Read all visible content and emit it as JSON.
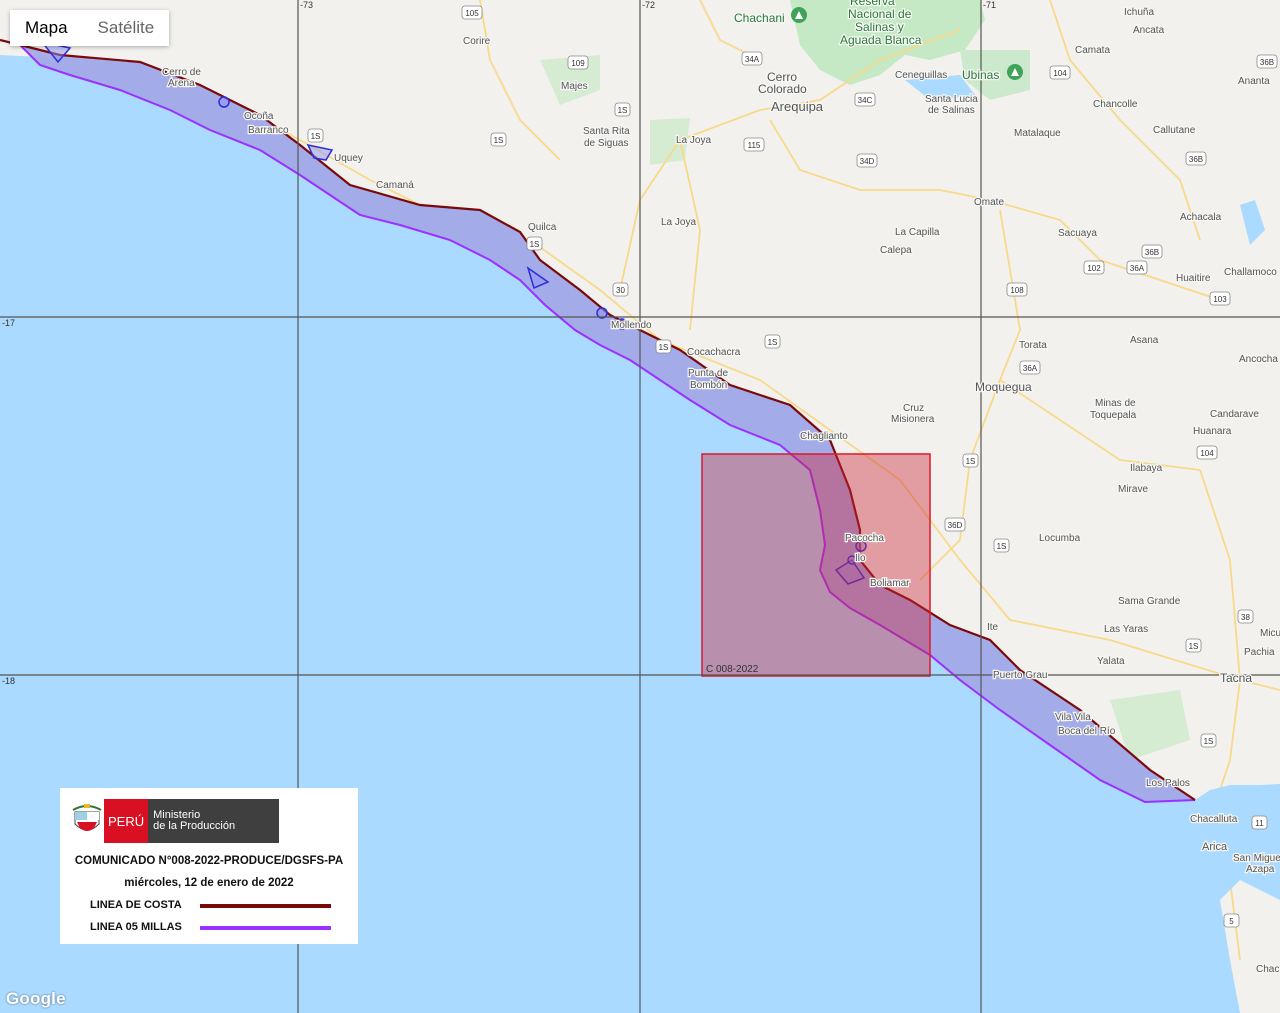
{
  "map_type": {
    "map_label": "Mapa",
    "satellite_label": "Satélite"
  },
  "grid": {
    "lon_labels": [
      "-73",
      "-72",
      "-71"
    ],
    "lat_labels": [
      "-17",
      "-18"
    ]
  },
  "places": [
    {
      "text": "Chachani"
    },
    {
      "text": "Reserva"
    },
    {
      "text": "Nacional de"
    },
    {
      "text": "Salinas y"
    },
    {
      "text": "Aguada Blanca"
    },
    {
      "text": "Ichuña"
    },
    {
      "text": "Ancata"
    },
    {
      "text": "Camata"
    },
    {
      "text": "Ananta"
    },
    {
      "text": "Corire"
    },
    {
      "text": "Cerro de"
    },
    {
      "text": "Arena"
    },
    {
      "text": "Majes"
    },
    {
      "text": "Cerro"
    },
    {
      "text": "Colorado"
    },
    {
      "text": "Arequipa"
    },
    {
      "text": "Ceneguillas"
    },
    {
      "text": "Ubinas"
    },
    {
      "text": "Santa Lucia"
    },
    {
      "text": "de Salinas"
    },
    {
      "text": "Chancolle"
    },
    {
      "text": "Ocoña"
    },
    {
      "text": "Barranco"
    },
    {
      "text": "Santa Rita"
    },
    {
      "text": "de Siguas"
    },
    {
      "text": "La Joya"
    },
    {
      "text": "Matalaque"
    },
    {
      "text": "Callutane"
    },
    {
      "text": "Uquey"
    },
    {
      "text": "Camaná"
    },
    {
      "text": "Omate"
    },
    {
      "text": "Achacala"
    },
    {
      "text": "Quilca"
    },
    {
      "text": "La Joya"
    },
    {
      "text": "La Capilla"
    },
    {
      "text": "Calepa"
    },
    {
      "text": "Sacuaya"
    },
    {
      "text": "Huaitire"
    },
    {
      "text": "Challamoco"
    },
    {
      "text": "Mollendo"
    },
    {
      "text": "Cocachacra"
    },
    {
      "text": "Torata"
    },
    {
      "text": "Asana"
    },
    {
      "text": "Ancocha"
    },
    {
      "text": "Punta de"
    },
    {
      "text": "Bombón"
    },
    {
      "text": "Moquegua"
    },
    {
      "text": "Cruz"
    },
    {
      "text": "Misionera"
    },
    {
      "text": "Minas de"
    },
    {
      "text": "Toquepala"
    },
    {
      "text": "Candarave"
    },
    {
      "text": "Huanara"
    },
    {
      "text": "Chaglianto"
    },
    {
      "text": "Ilabaya"
    },
    {
      "text": "Mirave"
    },
    {
      "text": "Pacocha"
    },
    {
      "text": "Ilo"
    },
    {
      "text": "Locumba"
    },
    {
      "text": "Boliamar"
    },
    {
      "text": "Sama Grande"
    },
    {
      "text": "Las Yaras"
    },
    {
      "text": "Ite"
    },
    {
      "text": "Micu"
    },
    {
      "text": "Pachia"
    },
    {
      "text": "Yalata"
    },
    {
      "text": "Puerto Grau"
    },
    {
      "text": "Tacna"
    },
    {
      "text": "Vila Vila"
    },
    {
      "text": "Boca del Río"
    },
    {
      "text": "Los Palos"
    },
    {
      "text": "Chacalluta"
    },
    {
      "text": "Arica"
    },
    {
      "text": "San Miguel de"
    },
    {
      "text": "Azapa"
    },
    {
      "text": "Chac"
    }
  ],
  "shields": [
    {
      "text": "105"
    },
    {
      "text": "109"
    },
    {
      "text": "1S"
    },
    {
      "text": "1S"
    },
    {
      "text": "1S"
    },
    {
      "text": "34A"
    },
    {
      "text": "34C"
    },
    {
      "text": "34D"
    },
    {
      "text": "115"
    },
    {
      "text": "104"
    },
    {
      "text": "36B"
    },
    {
      "text": "36B"
    },
    {
      "text": "1S"
    },
    {
      "text": "30"
    },
    {
      "text": "1S"
    },
    {
      "text": "1S"
    },
    {
      "text": "102"
    },
    {
      "text": "36A"
    },
    {
      "text": "36B"
    },
    {
      "text": "108"
    },
    {
      "text": "103"
    },
    {
      "text": "36A"
    },
    {
      "text": "1S"
    },
    {
      "text": "104"
    },
    {
      "text": "36D"
    },
    {
      "text": "1S"
    },
    {
      "text": "38"
    },
    {
      "text": "1S"
    },
    {
      "text": "1S"
    },
    {
      "text": "11"
    },
    {
      "text": "5"
    }
  ],
  "zone_label": "C 008-2022",
  "legend": {
    "peru_label": "PERÚ",
    "ministry_line1": "Ministerio",
    "ministry_line2": "de la Producción",
    "title": "COMUNICADO N°008-2022-PRODUCE/DGSFS-PA",
    "date": "miércoles, 12 de enero de 2022",
    "coast_label": "LINEA DE COSTA",
    "coast_color": "#7a0a0a",
    "five_miles_label": "LINEA 05 MILLAS",
    "five_miles_color": "#9b30ff"
  },
  "google_label": "Google",
  "colors": {
    "sea": "#aadaff",
    "land": "#f2f1ee",
    "buffer": "#a3a9e8",
    "zone": "rgba(205,40,60,0.42)"
  }
}
